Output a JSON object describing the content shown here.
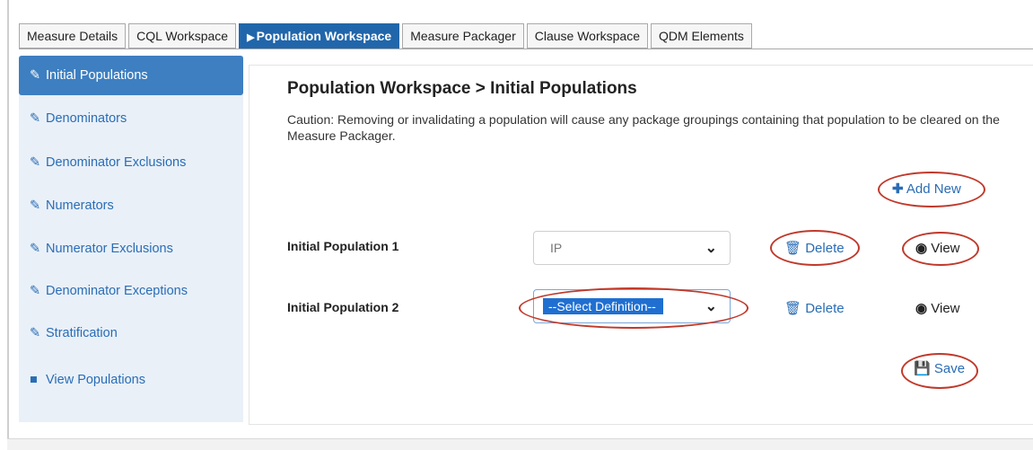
{
  "tabs": [
    {
      "label": "Measure Details",
      "active": false
    },
    {
      "label": "CQL Workspace",
      "active": false
    },
    {
      "label": "Population Workspace",
      "active": true
    },
    {
      "label": "Measure Packager",
      "active": false
    },
    {
      "label": "Clause Workspace",
      "active": false
    },
    {
      "label": "QDM Elements",
      "active": false
    }
  ],
  "sidebar": {
    "items": [
      {
        "label": "Initial Populations",
        "icon": "pencil-icon",
        "active": true
      },
      {
        "label": "Denominators",
        "icon": "pencil-icon"
      },
      {
        "label": "Denominator Exclusions",
        "icon": "pencil-icon"
      },
      {
        "label": "Numerators",
        "icon": "pencil-icon"
      },
      {
        "label": "Numerator Exclusions",
        "icon": "pencil-icon"
      },
      {
        "label": "Denominator Exceptions",
        "icon": "pencil-icon"
      },
      {
        "label": "Stratification",
        "icon": "pencil-icon"
      },
      {
        "label": "View Populations",
        "icon": "book-icon"
      }
    ]
  },
  "main": {
    "title": "Population Workspace > Initial Populations",
    "caution": "Caution: Removing or invalidating a population will cause any package groupings containing that population to be cleared on the Measure Packager.",
    "add_new_label": "Add New",
    "rows": [
      {
        "label": "Initial Population 1",
        "selected": "IP",
        "delete_label": "Delete",
        "view_label": "View"
      },
      {
        "label": "Initial Population 2",
        "selected": "--Select Definition--",
        "delete_label": "Delete",
        "view_label": "View"
      }
    ],
    "save_label": "Save"
  },
  "colors": {
    "active_tab": "#2166ab",
    "link": "#2a6db5",
    "annotation": "#c0392b",
    "sidebar_bg": "#e9f0f8"
  }
}
